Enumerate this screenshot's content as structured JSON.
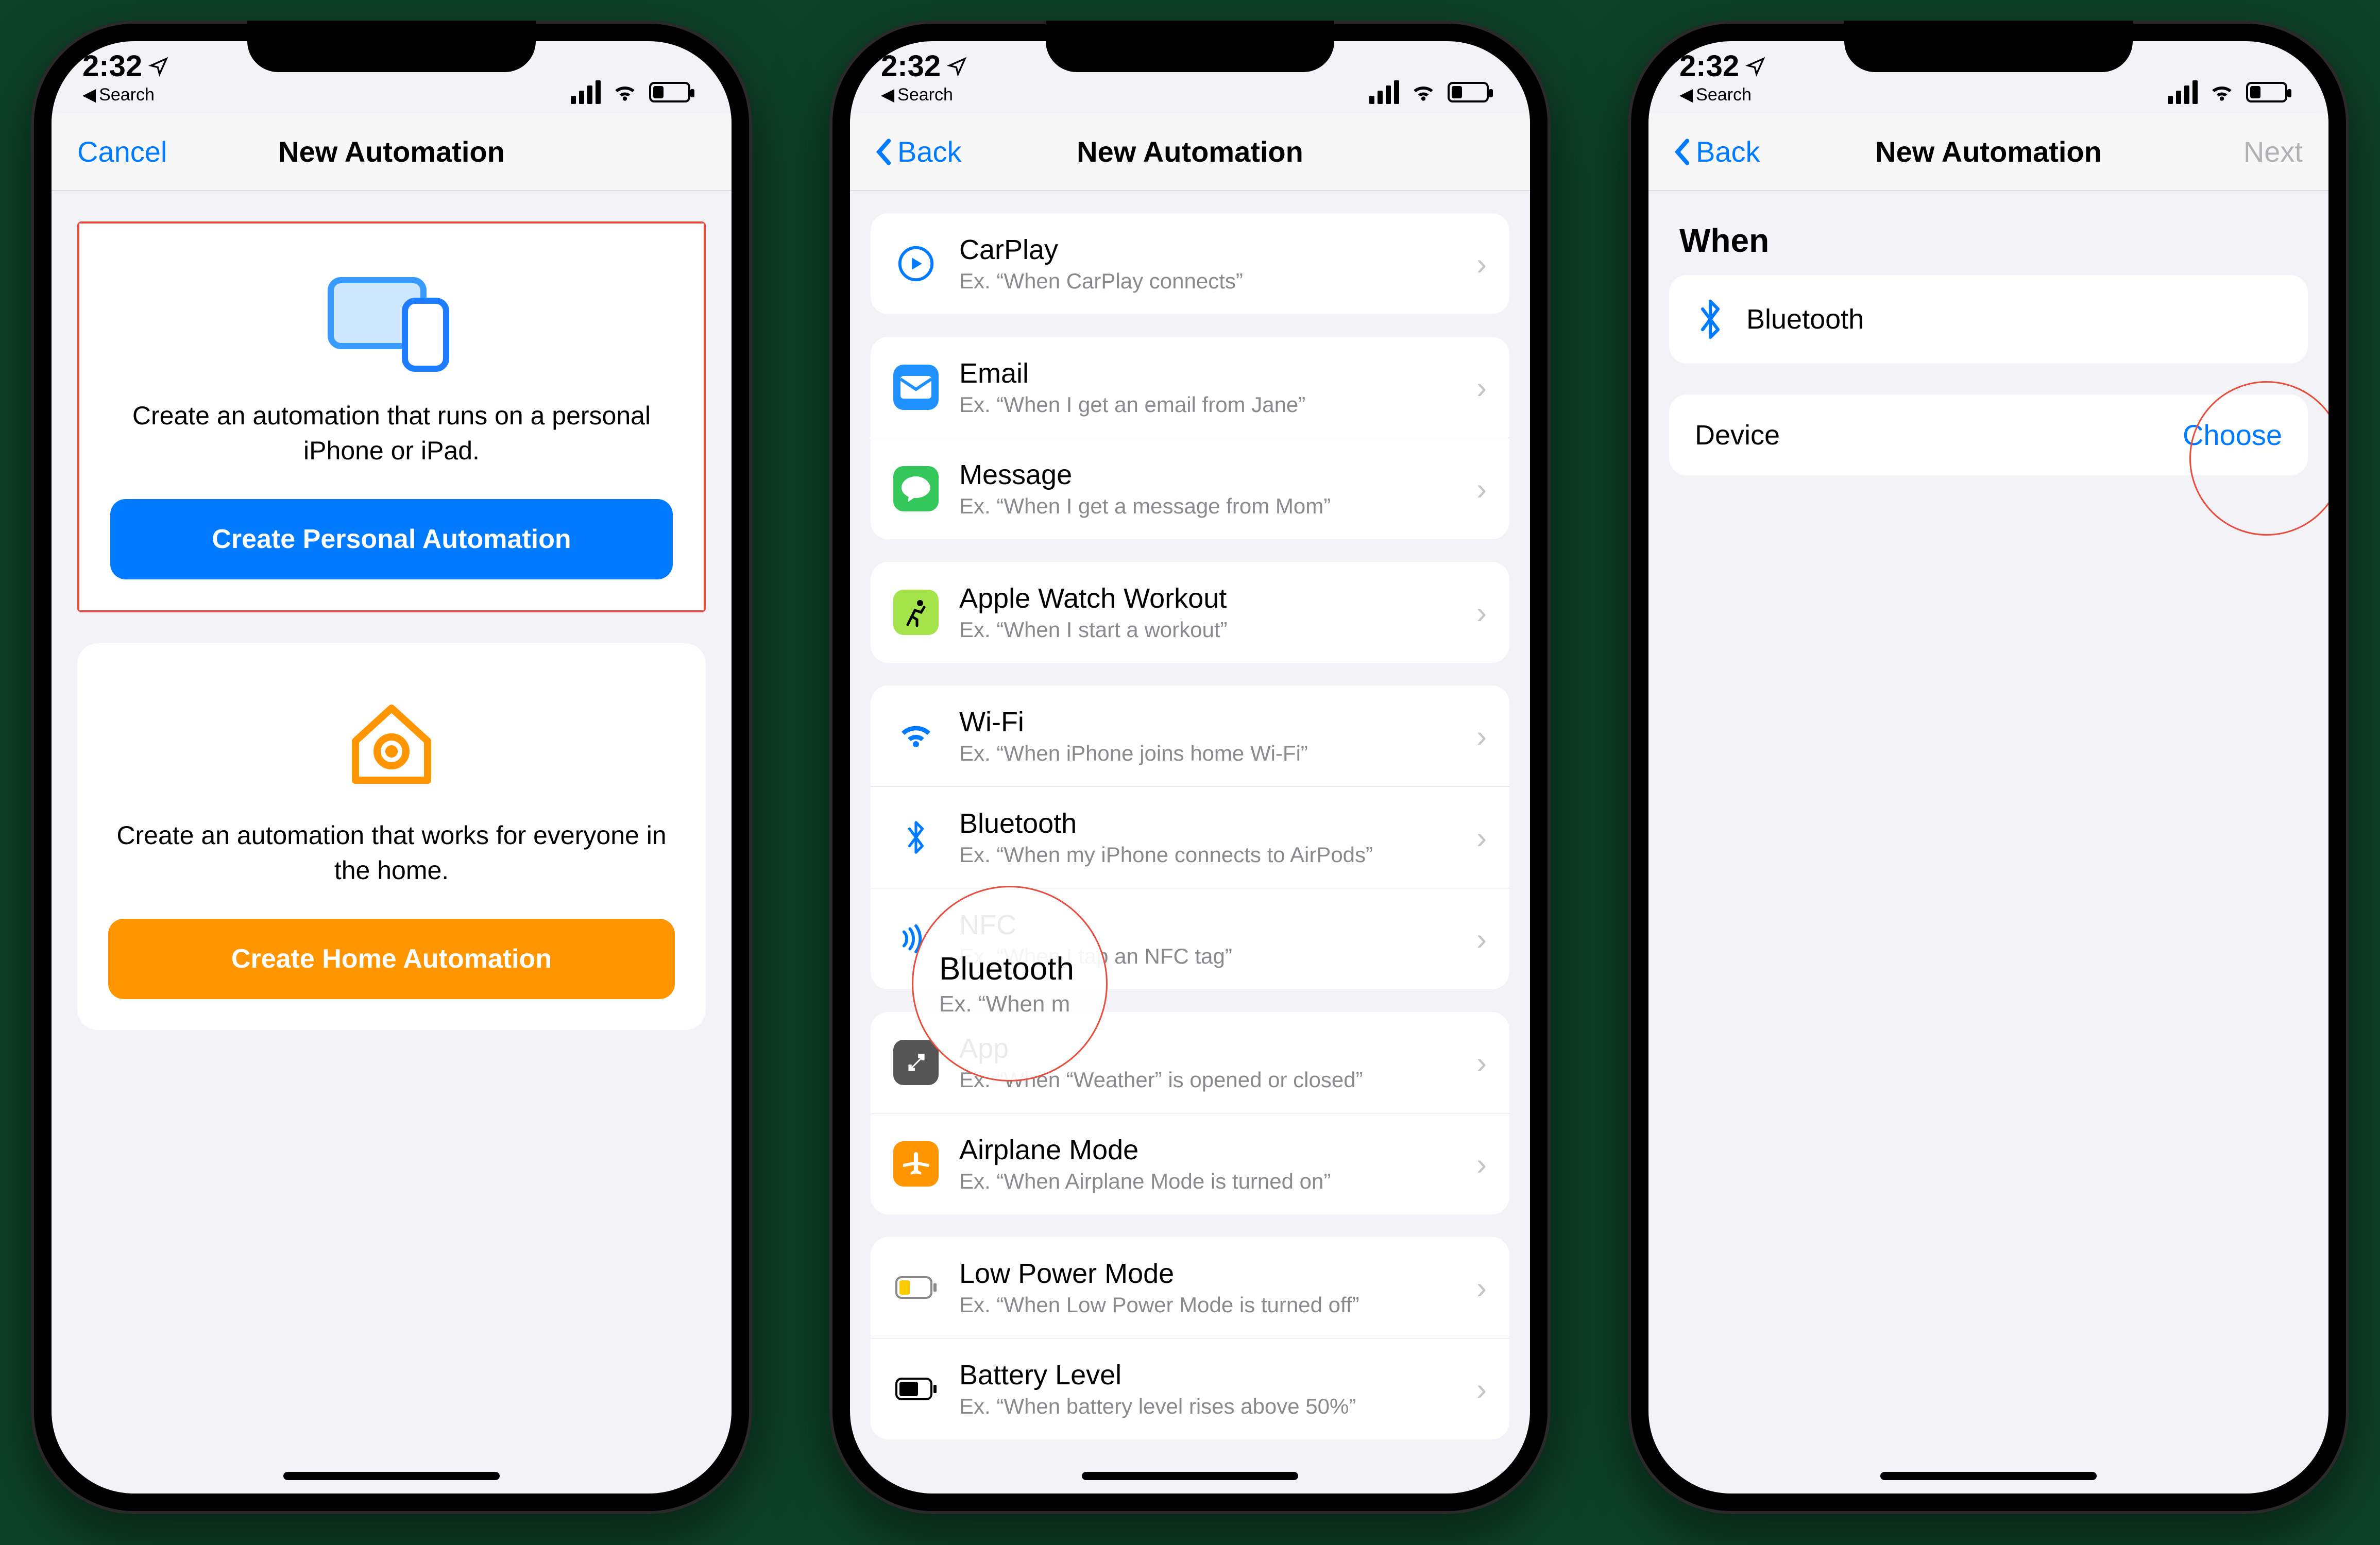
{
  "status": {
    "time": "2:32",
    "back_crumb": "Search"
  },
  "screen1": {
    "nav": {
      "left": "Cancel",
      "title": "New Automation"
    },
    "personal": {
      "desc": "Create an automation that runs on a personal iPhone or iPad.",
      "button": "Create Personal Automation"
    },
    "home": {
      "desc": "Create an automation that works for everyone in the home.",
      "button": "Create Home Automation"
    }
  },
  "screen2": {
    "nav": {
      "left": "Back",
      "title": "New Automation"
    },
    "groups": [
      [
        {
          "icon": "carplay",
          "title": "CarPlay",
          "sub": "Ex. “When CarPlay connects”"
        }
      ],
      [
        {
          "icon": "email",
          "title": "Email",
          "sub": "Ex. “When I get an email from Jane”"
        },
        {
          "icon": "message",
          "title": "Message",
          "sub": "Ex. “When I get a message from Mom”"
        }
      ],
      [
        {
          "icon": "workout",
          "title": "Apple Watch Workout",
          "sub": "Ex. “When I start a workout”"
        }
      ],
      [
        {
          "icon": "wifi",
          "title": "Wi-Fi",
          "sub": "Ex. “When iPhone joins home Wi-Fi”"
        },
        {
          "icon": "bluetooth",
          "title": "Bluetooth",
          "sub": "Ex. “When my iPhone connects to AirPods”"
        },
        {
          "icon": "nfc",
          "title": "NFC",
          "sub": "Ex. “When I tap an NFC tag”"
        }
      ],
      [
        {
          "icon": "app",
          "title": "App",
          "sub": "Ex. “When “Weather” is opened or closed”"
        },
        {
          "icon": "airplane",
          "title": "Airplane Mode",
          "sub": "Ex. “When Airplane Mode is turned on”"
        }
      ],
      [
        {
          "icon": "lowpower",
          "title": "Low Power Mode",
          "sub": "Ex. “When Low Power Mode is turned off”"
        },
        {
          "icon": "battery",
          "title": "Battery Level",
          "sub": "Ex. “When battery level rises above 50%”"
        }
      ]
    ],
    "highlight": {
      "title": "Bluetooth",
      "sub": "Ex. “When m"
    }
  },
  "screen3": {
    "nav": {
      "left": "Back",
      "title": "New Automation",
      "right": "Next"
    },
    "section": "When",
    "trigger": {
      "label": "Bluetooth"
    },
    "device": {
      "label": "Device",
      "value": "Choose"
    }
  },
  "icons": {
    "carplay": {
      "bg": "#ffffff",
      "stroke": "#007aff"
    },
    "email": {
      "bg": "#1e90ff"
    },
    "message": {
      "bg": "#34c759"
    },
    "workout": {
      "bg": "#a4e34a"
    },
    "wifi": {
      "bg": "#ffffff",
      "fg": "#007aff"
    },
    "bluetooth": {
      "bg": "#ffffff",
      "fg": "#007aff"
    },
    "nfc": {
      "bg": "#ffffff",
      "fg": "#007aff"
    },
    "app": {
      "bg": "#555555"
    },
    "airplane": {
      "bg": "#ff9500"
    },
    "lowpower": {
      "bg": "#ffffff"
    },
    "battery": {
      "bg": "#ffffff"
    }
  }
}
